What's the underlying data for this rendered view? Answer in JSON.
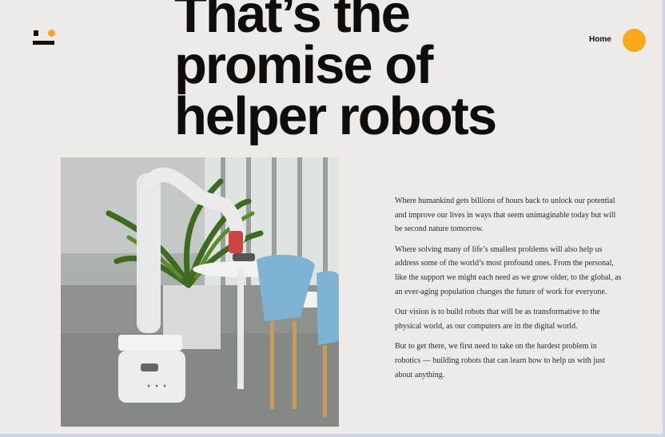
{
  "header": {
    "nav_home": "Home",
    "accent_color": "#f7a81b"
  },
  "hero": {
    "title_lines": [
      "That’s the",
      "promise of",
      "helper robots"
    ]
  },
  "body": {
    "paragraphs": [
      "Where humankind gets billions of hours back to unlock our potential and improve our lives in ways that seem unimaginable today but will be second nature tomorrow.",
      "Where solving many of life’s smallest problems will also help us address some of the world’s most profound ones. From the personal, like the support we might each need as we grow older, to the global, as an ever-aging population changes the future of work for everyone.",
      "Our vision is to build robots that will be as transformative to the physical world, as our computers are in the digital world.",
      "But to get there, we first need to take on the hardest problem in robotics — building robots that can learn how to help us with just about anything."
    ]
  },
  "icons": {
    "logo": "robot-face-logo-icon",
    "nav_circle": "menu-circle-icon"
  }
}
